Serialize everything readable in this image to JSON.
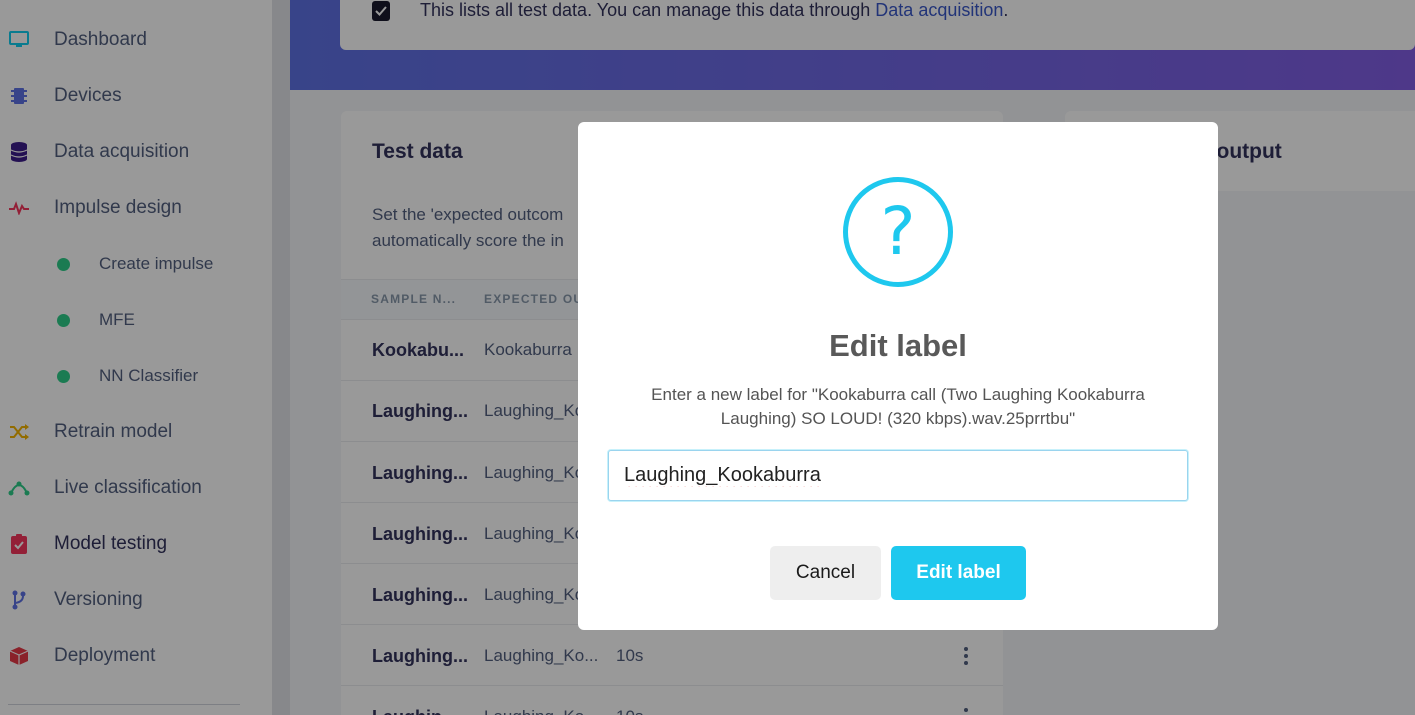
{
  "sidebar": {
    "items": [
      {
        "label": "Dashboard",
        "icon": "monitor-icon"
      },
      {
        "label": "Devices",
        "icon": "chip-icon"
      },
      {
        "label": "Data acquisition",
        "icon": "database-icon"
      },
      {
        "label": "Impulse design",
        "icon": "pulse-icon"
      },
      {
        "label": "Create impulse",
        "icon": "dot-icon"
      },
      {
        "label": "MFE",
        "icon": "dot-icon"
      },
      {
        "label": "NN Classifier",
        "icon": "dot-icon"
      },
      {
        "label": "Retrain model",
        "icon": "shuffle-icon"
      },
      {
        "label": "Live classification",
        "icon": "network-icon"
      },
      {
        "label": "Model testing",
        "icon": "clipboard-check-icon"
      },
      {
        "label": "Versioning",
        "icon": "git-branch-icon"
      },
      {
        "label": "Deployment",
        "icon": "package-icon"
      }
    ]
  },
  "info": {
    "text": "This lists all test data. You can manage this data through ",
    "link": "Data acquisition",
    "suffix": "."
  },
  "test_card": {
    "title": "Test data",
    "desc_line1": "Set the 'expected outcom",
    "desc_line2": "automatically score the in",
    "col_name": "SAMPLE N...",
    "col_expected": "EXPECTED OU",
    "rows": [
      {
        "name": "Kookabu...",
        "expected": "Kookaburra",
        "length": ""
      },
      {
        "name": "Laughing...",
        "expected": "Laughing_Ko",
        "length": ""
      },
      {
        "name": "Laughing...",
        "expected": "Laughing_Ko",
        "length": ""
      },
      {
        "name": "Laughing...",
        "expected": "Laughing_Ko",
        "length": ""
      },
      {
        "name": "Laughing...",
        "expected": "Laughing_Ko",
        "length": ""
      },
      {
        "name": "Laughing...",
        "expected": "Laughing_Ko...",
        "length": "10s"
      },
      {
        "name": "Laughin...",
        "expected": "Laughing_Ko",
        "length": "10s"
      }
    ]
  },
  "right_card": {
    "title": "ng output"
  },
  "modal": {
    "icon": "question-icon",
    "title": "Edit label",
    "message": "Enter a new label for \"Kookaburra call (Two Laughing Kookaburra Laughing) SO LOUD! (320 kbps).wav.25prrtbu\"",
    "input_value": "Laughing_Kookaburra",
    "cancel_label": "Cancel",
    "confirm_label": "Edit label"
  },
  "colors": {
    "accent": "#1ec8ee",
    "header_gradient_start": "#5e72e4",
    "header_gradient_end": "#825ee4",
    "status_green": "#2dce89"
  }
}
